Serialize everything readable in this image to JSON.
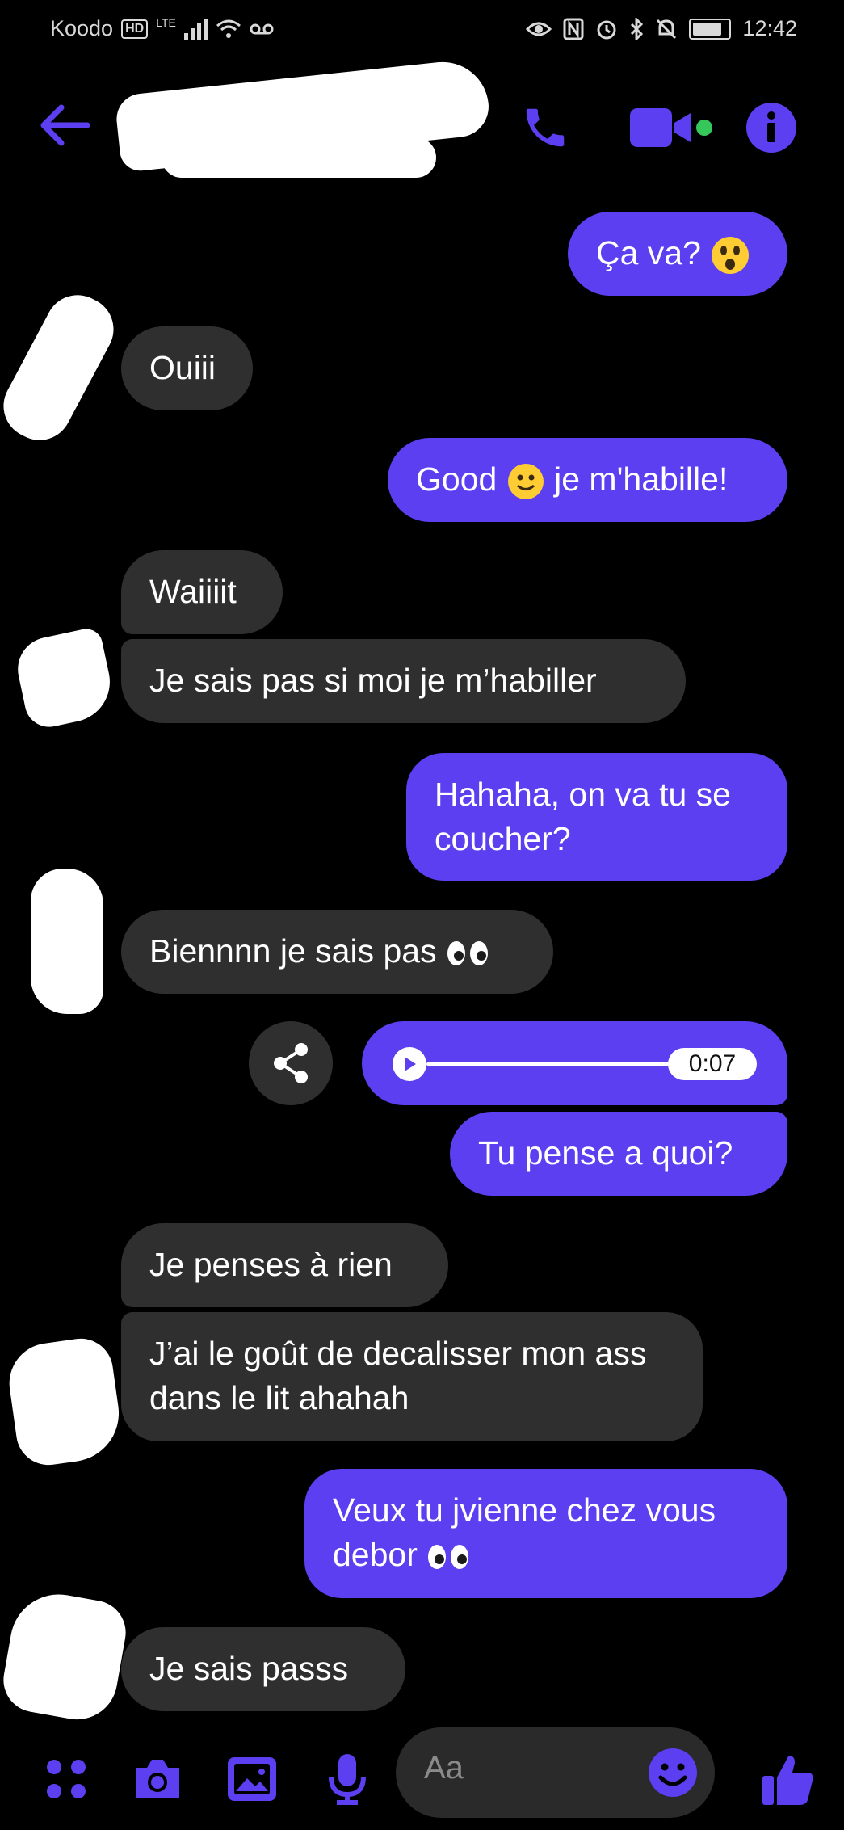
{
  "status_bar": {
    "carrier": "Koodo",
    "hd_badge": "HD",
    "network": "LTE",
    "time": "12:42"
  },
  "header": {
    "contact_name": ""
  },
  "colors": {
    "accent": "#5b3ff0",
    "incoming_bubble": "#2f2f2f",
    "background": "#000000",
    "online_dot": "#35c759"
  },
  "messages": [
    {
      "side": "out",
      "text": "Ça va?",
      "emoji": "astonished-face"
    },
    {
      "side": "in",
      "text": "Ouiii"
    },
    {
      "side": "out",
      "text": "Good",
      "emoji": "slightly-smiling-face",
      "text_after": "je m'habille!"
    },
    {
      "side": "in",
      "text": "Waiiiit"
    },
    {
      "side": "in",
      "text": "Je sais pas si moi je m’habiller"
    },
    {
      "side": "out",
      "text": "Hahaha, on va tu se coucher?"
    },
    {
      "side": "in",
      "text": "Biennnn je sais pas",
      "emoji": "eyes"
    },
    {
      "side": "out",
      "type": "audio",
      "duration": "0:07",
      "progress": 0
    },
    {
      "side": "out",
      "text": "Tu pense a quoi?"
    },
    {
      "side": "in",
      "text": "Je penses à rien"
    },
    {
      "side": "in",
      "text": "J’ai le goût de decalisser mon ass dans le lit ahahah"
    },
    {
      "side": "out",
      "text": "Veux tu jvienne chez vous debor",
      "emoji": "eyes"
    },
    {
      "side": "in",
      "text": "Je sais passs"
    }
  ],
  "composer": {
    "placeholder": "Aa",
    "icons": [
      "menu-dots-icon",
      "camera-icon",
      "gallery-icon",
      "microphone-icon",
      "emoji-icon",
      "thumbs-up-icon"
    ]
  }
}
